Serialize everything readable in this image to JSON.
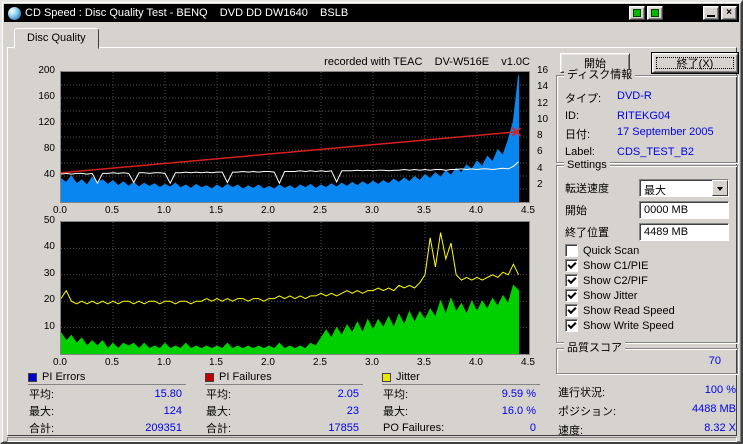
{
  "window": {
    "title": "CD Speed : Disc Quality Test - BENQ    DVD DD DW1640    BSLB",
    "controls": {
      "minimize_label": "_",
      "close_label": "×"
    }
  },
  "tab": {
    "label": "Disc Quality"
  },
  "header": {
    "recorded_with": "recorded with TEAC    DV-W516E    v1.0C"
  },
  "actions": {
    "start_label": "開始",
    "exit_label": "終了(X)"
  },
  "disc_info": {
    "group_title": "ディスク情報",
    "fields": [
      {
        "label": "タイプ:",
        "value": "DVD-R"
      },
      {
        "label": "ID:",
        "value": "RITEKG04"
      },
      {
        "label": "日付:",
        "value": "17 September 2005"
      },
      {
        "label": "Label:",
        "value": "CDS_TEST_B2"
      }
    ]
  },
  "settings": {
    "group_title": "Settings",
    "speed": {
      "label": "転送速度",
      "value": "最大"
    },
    "start": {
      "label": "開始",
      "value": "0000 MB"
    },
    "end": {
      "label": "終了位置",
      "value": "4489 MB"
    },
    "checkboxes": [
      {
        "label": "Quick Scan",
        "checked": false
      },
      {
        "label": "Show C1/PIE",
        "checked": true
      },
      {
        "label": "Show C2/PIF",
        "checked": true
      },
      {
        "label": "Show Jitter",
        "checked": true
      },
      {
        "label": "Show Read Speed",
        "checked": true
      },
      {
        "label": "Show Write Speed",
        "checked": true
      }
    ]
  },
  "quality": {
    "label": "品質スコア",
    "value": "70"
  },
  "status": {
    "rows": [
      {
        "label": "進行状況:",
        "value": "100 %"
      },
      {
        "label": "ポジション:",
        "value": "4488 MB"
      },
      {
        "label": "速度:",
        "value": "8.32 X"
      }
    ]
  },
  "legend": {
    "sections": [
      {
        "title": "PI Errors",
        "color": "#0000cc",
        "rows": [
          {
            "label": "平均:",
            "value": "15.80"
          },
          {
            "label": "最大:",
            "value": "124"
          },
          {
            "label": "合計:",
            "value": "209351"
          }
        ]
      },
      {
        "title": "PI Failures",
        "color": "#c00000",
        "rows": [
          {
            "label": "平均:",
            "value": "2.05"
          },
          {
            "label": "最大:",
            "value": "23"
          },
          {
            "label": "合計:",
            "value": "17855"
          }
        ]
      },
      {
        "title": "Jitter",
        "color": "#e8e800",
        "rows": [
          {
            "label": "平均:",
            "value": "9.59 %"
          },
          {
            "label": "最大:",
            "value": "16.0 %"
          },
          {
            "label": "PO Failures:",
            "value": "0"
          }
        ]
      }
    ]
  },
  "colors": {
    "window_gray": "#d6d3ce",
    "value_text": "#0000e8",
    "chart_bg": "#000000"
  },
  "chart_data": [
    {
      "type": "area",
      "title": "PI Errors / Read & Write Speed vs position (GB)",
      "x_range": [
        0,
        4.5
      ],
      "x_grid": 0.5,
      "x_ticks": [
        "0.0",
        "0.5",
        "1.0",
        "1.5",
        "2.0",
        "2.5",
        "3.0",
        "3.5",
        "4.0",
        "4.5"
      ],
      "y_left": {
        "range": [
          0,
          200
        ],
        "grid": 20,
        "ticks": [
          40,
          80,
          120,
          160,
          200
        ]
      },
      "y_right": {
        "range": [
          0,
          16
        ],
        "ticks": [
          2,
          4,
          6,
          8,
          10,
          12,
          14,
          16
        ]
      },
      "series": [
        {
          "name": "PI Errors",
          "type": "area",
          "color": "#0a86f0",
          "x_step": 0.05,
          "values": [
            36,
            30,
            40,
            28,
            34,
            26,
            38,
            30,
            34,
            27,
            33,
            25,
            31,
            24,
            30,
            23,
            29,
            24,
            28,
            22,
            27,
            23,
            29,
            22,
            26,
            21,
            27,
            22,
            25,
            20,
            26,
            21,
            27,
            22,
            26,
            20,
            25,
            21,
            26,
            20,
            24,
            20,
            26,
            21,
            25,
            20,
            26,
            22,
            27,
            21,
            26,
            22,
            28,
            23,
            29,
            24,
            30,
            25,
            31,
            26,
            32,
            27,
            33,
            28,
            35,
            30,
            37,
            31,
            39,
            33,
            42,
            36,
            45,
            38,
            48,
            41,
            52,
            45,
            57,
            50,
            63,
            55,
            70,
            62,
            80,
            72,
            95,
            124,
            195
          ]
        },
        {
          "name": "Read Speed",
          "type": "line",
          "color": "#ffffff",
          "x_step": 0.05,
          "values": [
            43,
            44,
            43,
            44,
            44,
            43,
            44,
            29,
            44,
            44,
            45,
            44,
            45,
            44,
            30,
            45,
            45,
            44,
            45,
            45,
            44,
            29,
            45,
            45,
            46,
            45,
            46,
            45,
            46,
            45,
            46,
            46,
            30,
            46,
            46,
            47,
            46,
            47,
            46,
            47,
            47,
            46,
            29,
            47,
            47,
            47,
            48,
            47,
            48,
            47,
            48,
            47,
            48,
            31,
            48,
            48,
            48,
            49,
            48,
            49,
            48,
            49,
            49,
            48,
            49,
            49,
            50,
            49,
            50,
            49,
            50,
            49,
            50,
            50,
            49,
            50,
            50,
            51,
            50,
            51,
            50,
            51,
            51,
            50,
            51,
            52,
            51,
            55,
            62
          ]
        },
        {
          "name": "Write Speed",
          "type": "line",
          "color": "#d82020",
          "width": 1.5,
          "end_marker": true,
          "points": [
            [
              0,
              45
            ],
            [
              4.38,
              108
            ]
          ]
        }
      ]
    },
    {
      "type": "area",
      "title": "PI Failures / Jitter vs position (GB)",
      "x_range": [
        0,
        4.5
      ],
      "x_grid": 0.5,
      "x_ticks": [
        "0.0",
        "0.5",
        "1.0",
        "1.5",
        "2.0",
        "2.5",
        "3.0",
        "3.5",
        "4.0",
        "4.5"
      ],
      "y_left": {
        "range": [
          0,
          50
        ],
        "grid": 10,
        "ticks": [
          10,
          20,
          30,
          40,
          50
        ]
      },
      "series": [
        {
          "name": "PI Failures",
          "type": "area",
          "color": "#00d000",
          "x_step": 0.05,
          "values": [
            8,
            5,
            7,
            4,
            6,
            3,
            5,
            3,
            5,
            2,
            4,
            2,
            4,
            3,
            4,
            2,
            4,
            2,
            3,
            2,
            4,
            2,
            3,
            2,
            4,
            2,
            3,
            2,
            3,
            2,
            3,
            2,
            4,
            2,
            3,
            2,
            3,
            2,
            3,
            2,
            3,
            2,
            4,
            2,
            3,
            2,
            3,
            2,
            4,
            3,
            6,
            9,
            6,
            10,
            7,
            11,
            8,
            12,
            8,
            13,
            9,
            13,
            10,
            14,
            10,
            15,
            11,
            16,
            12,
            16,
            13,
            17,
            14,
            20,
            15,
            21,
            16,
            19,
            15,
            20,
            16,
            20,
            17,
            21,
            18,
            22,
            19,
            26,
            24
          ]
        },
        {
          "name": "Jitter",
          "type": "line",
          "color": "#ffff00",
          "x_step": 0.05,
          "values": [
            21,
            24,
            20,
            19,
            20,
            19,
            20,
            19,
            20,
            19,
            20,
            19,
            20,
            20,
            19,
            20,
            19,
            20,
            20,
            19,
            20,
            20,
            19,
            20,
            20,
            19,
            20,
            20,
            21,
            20,
            21,
            20,
            21,
            20,
            21,
            21,
            20,
            21,
            21,
            20,
            21,
            21,
            22,
            21,
            22,
            21,
            22,
            21,
            22,
            22,
            23,
            22,
            23,
            22,
            23,
            24,
            23,
            24,
            23,
            24,
            24,
            25,
            24,
            25,
            24,
            26,
            25,
            26,
            25,
            27,
            30,
            44,
            33,
            46,
            36,
            42,
            30,
            28,
            29,
            28,
            29,
            28,
            29,
            30,
            29,
            31,
            30,
            34,
            30
          ]
        }
      ]
    }
  ]
}
